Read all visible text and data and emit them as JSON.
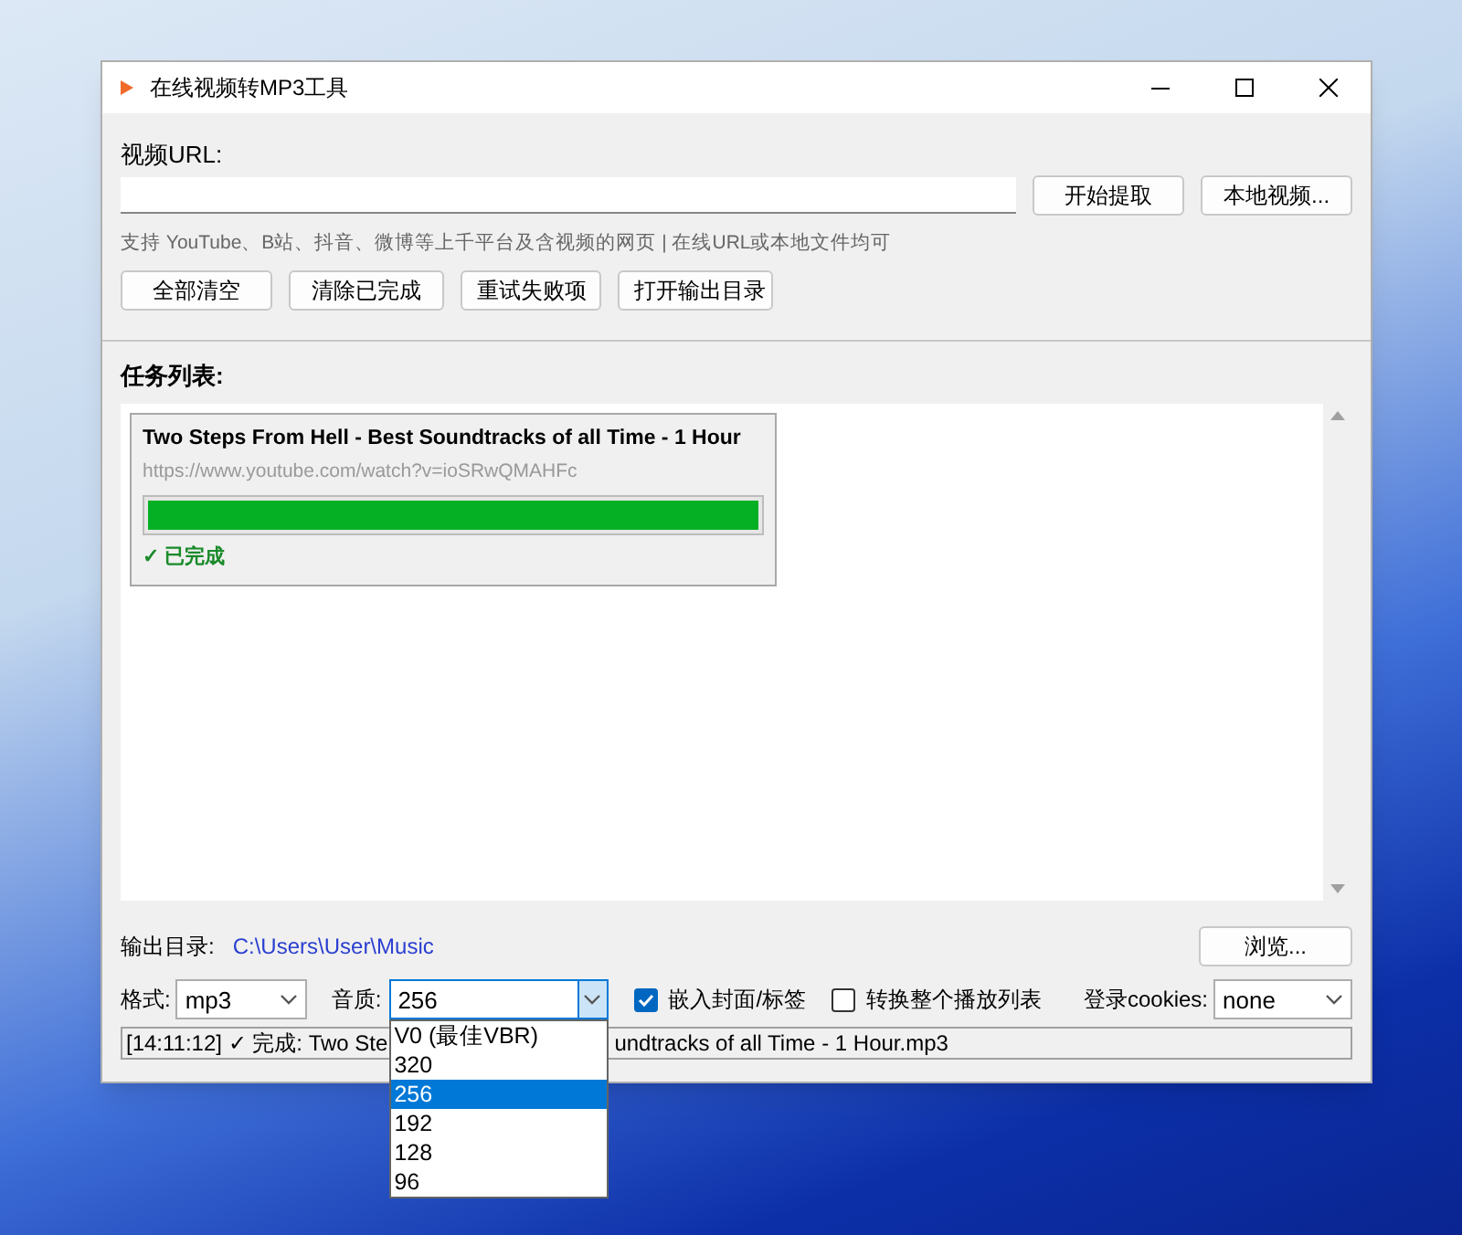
{
  "window": {
    "title": "在线视频转MP3工具"
  },
  "url": {
    "label": "视频URL:",
    "buttons": [
      "开始提取",
      "本地视频..."
    ],
    "hint": "支持 YouTube、B站、抖音、微博等上千平台及含视频的网页 | 在线URL或本地文件均可"
  },
  "actions": [
    "全部清空",
    "清除已完成",
    "重试失败项",
    "打开输出目录"
  ],
  "tasks": {
    "label": "任务列表:",
    "items": [
      {
        "title": "Two Steps From Hell - Best Soundtracks of all Time - 1 Hour",
        "url": "https://www.youtube.com/watch?v=ioSRwQMAHFc",
        "level": 1,
        "status": "✓ 已完成"
      }
    ]
  },
  "output": {
    "label": "输出目录:",
    "path": "C:\\Users\\User\\Music",
    "button": "浏览..."
  },
  "options": {
    "format": {
      "label": "格式:",
      "value": "mp3"
    },
    "quality": {
      "label": "音质:",
      "value": "256",
      "expanded": true,
      "options": [
        {
          "label": "V0 (最佳VBR)",
          "selected": false
        },
        {
          "label": "320",
          "selected": false
        },
        {
          "label": "256",
          "selected": true
        },
        {
          "label": "192",
          "selected": false
        },
        {
          "label": "128",
          "selected": false
        },
        {
          "label": "96",
          "selected": false
        }
      ]
    },
    "checkboxes": [
      {
        "label": "嵌入封面/标签",
        "checked": true
      },
      {
        "label": "转换整个播放列表",
        "checked": false
      }
    ],
    "cookies": {
      "label": "登录cookies:",
      "value": "none"
    }
  },
  "status_bar": {
    "parts": [
      "[14:11:12] ✓ 完成: Two Ste",
      "undtracks of all Time - 1 Hour.mp3"
    ]
  }
}
